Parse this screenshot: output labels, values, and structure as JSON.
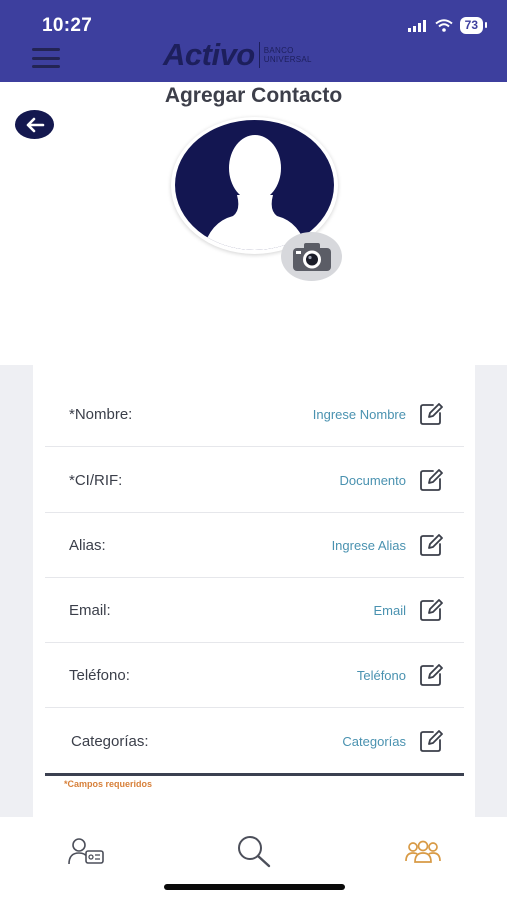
{
  "status_bar": {
    "time": "10:27",
    "battery": "73",
    "icons": [
      "signal-icon",
      "wifi-icon",
      "battery-icon"
    ]
  },
  "header": {
    "logo_text": "Activo",
    "logo_subtext": "BANCO UNIVERSAL",
    "menu_icon": "hamburger-menu-icon",
    "brand_color": "#3d3f9e"
  },
  "page": {
    "title": "Agregar Contacto",
    "back_icon": "arrow-left-icon"
  },
  "avatar": {
    "icon": "user-silhouette-icon",
    "camera_icon": "camera-icon"
  },
  "form": {
    "fields": [
      {
        "label": "*Nombre:",
        "value": "Ingrese Nombre",
        "icon": "edit-icon"
      },
      {
        "label": "*CI/RIF:",
        "value": "Documento",
        "icon": "edit-icon"
      },
      {
        "label": "Alias:",
        "value": "Ingrese Alias",
        "icon": "edit-icon"
      },
      {
        "label": "Email:",
        "value": "Email",
        "icon": "edit-icon"
      },
      {
        "label": "Teléfono:",
        "value": "Teléfono",
        "icon": "edit-icon"
      },
      {
        "label": "Categorías:",
        "value": "Categorías",
        "icon": "edit-icon"
      }
    ],
    "required_note": "*Campos requeridos",
    "value_color": "#4a92b0",
    "note_color": "#d7803a"
  },
  "bottom_nav": {
    "items": [
      {
        "icon": "contact-card-icon",
        "active": false
      },
      {
        "icon": "search-icon",
        "active": false
      },
      {
        "icon": "users-group-icon",
        "active": true
      }
    ],
    "active_color": "#d89a45"
  }
}
